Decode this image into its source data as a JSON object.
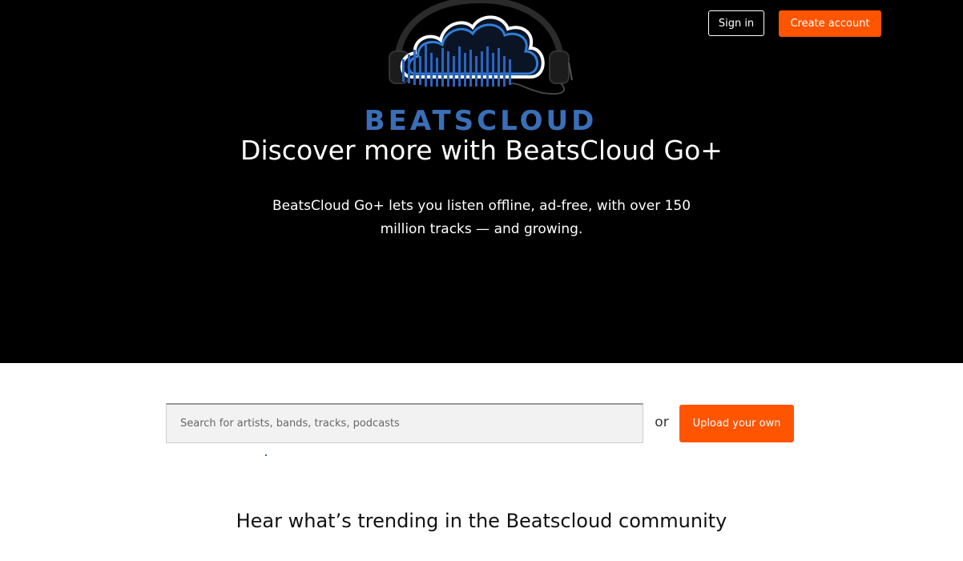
{
  "brand": {
    "wordmark": "BEATSCLOUD",
    "logo_icon": "cloud-headphones-equalizer-logo",
    "accent": "#ff5500",
    "logo_blue": "#2a6fd6"
  },
  "header": {
    "signin_label": "Sign in",
    "create_account_label": "Create account"
  },
  "hero": {
    "title": "Discover more with BeatsCloud Go+",
    "subtitle": "BeatsCloud Go+ lets you listen offline, ad-free, with over 150 million tracks — and growing."
  },
  "search": {
    "placeholder": "Search for artists, bands, tracks, podcasts",
    "or_label": "or",
    "upload_label": "Upload your own"
  },
  "trending": {
    "title": "Hear what’s trending in the Beatscloud community"
  }
}
